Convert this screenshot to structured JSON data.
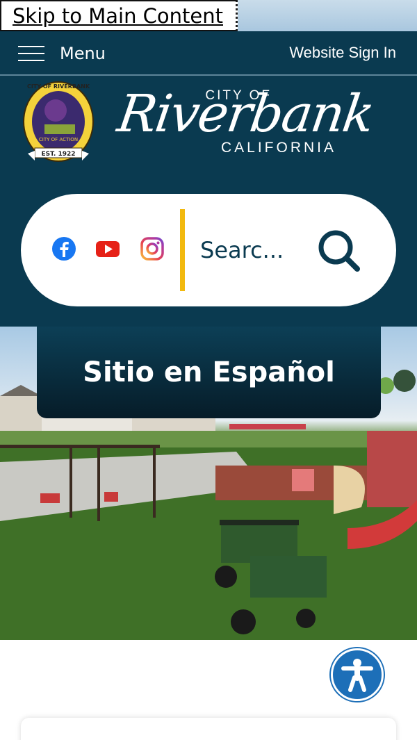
{
  "skip_link": {
    "label": "Skip to Main Content"
  },
  "menu": {
    "label": "Menu"
  },
  "signin": {
    "label": "Website Sign In"
  },
  "logo": {
    "city_of": "CITY OF",
    "name": "Riverbank",
    "state": "CALIFORNIA",
    "seal_text": [
      "CITY OF RIVERBANK",
      "CITY OF ACTION",
      "EST. 1922"
    ]
  },
  "social": [
    {
      "name": "Facebook",
      "icon": "facebook-icon",
      "color": "#1877f2"
    },
    {
      "name": "YouTube",
      "icon": "youtube-icon",
      "color": "#e62117"
    },
    {
      "name": "Instagram",
      "icon": "instagram-icon",
      "color": "#c13584"
    }
  ],
  "search": {
    "placeholder": "Searc..."
  },
  "espanol": {
    "label": "Sitio en Español"
  },
  "colors": {
    "navy": "#0a3a50",
    "accent": "#f2b90f",
    "a11y": "#1d6fb8"
  }
}
